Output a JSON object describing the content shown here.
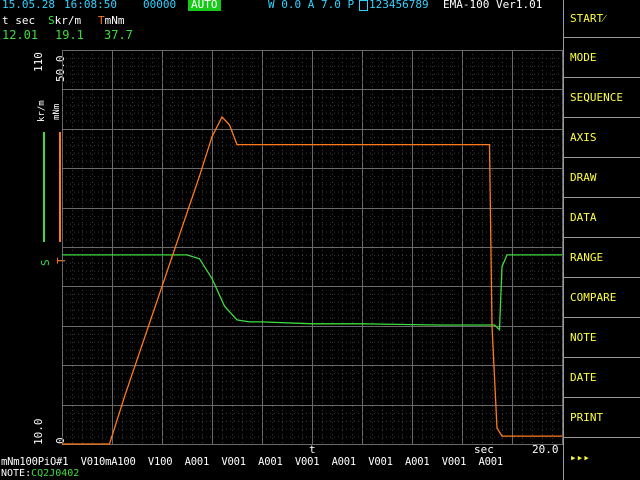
{
  "header": {
    "date": "15.05.28",
    "time": "16:08:50",
    "counter": "00000",
    "auto_badge": "AUTO",
    "mode_status": "W 0.0 A 7.0 P",
    "id_icon": "id-card-icon",
    "serial": "123456789",
    "model": "EMA-100 Ver1.01"
  },
  "readout": {
    "t_label": "t sec",
    "s_label": "Skr/m",
    "s_prefix": "S",
    "s_suffix": "kr/m",
    "t_chan_prefix": "T",
    "t_chan_suffix": "mNm",
    "t_value": "12.01",
    "s_value": "19.1",
    "tq_value": "37.7"
  },
  "axes": {
    "s_unit": "kr/m",
    "t_unit": "mNm",
    "s_max": "110",
    "t_max": "50.0",
    "s_min": "10.0",
    "t_min": "0",
    "s_marker": "S",
    "t_marker": "T",
    "x_label": "t",
    "x_unit": "sec",
    "x_max": "20.0"
  },
  "footer": {
    "config_line": "mNm100PiO#1  V010mA100  V100  A001  V001  A001  V001  A001  V001  A001  V001  A001",
    "note_label": "NOTE:",
    "note_value": "CQ2J0402"
  },
  "sidebar": {
    "items": [
      {
        "label": "START⁄"
      },
      {
        "label": "MODE"
      },
      {
        "label": "SEQUENCE"
      },
      {
        "label": "AXIS"
      },
      {
        "label": "DRAW"
      },
      {
        "label": "DATA"
      },
      {
        "label": "RANGE"
      },
      {
        "label": "COMPARE"
      },
      {
        "label": "NOTE"
      },
      {
        "label": "DATE"
      },
      {
        "label": "PRINT"
      },
      {
        "label": "▸▸▸"
      }
    ]
  },
  "colors": {
    "speed": "#3ddc3d",
    "torque": "#ff7a1a",
    "grid": "#6a6a6a",
    "header_cyan": "#32d2ff",
    "menu_text": "#ffff3c"
  },
  "chart_data": {
    "type": "line",
    "xlabel": "t",
    "x_unit": "sec",
    "xlim": [
      0,
      20
    ],
    "series": [
      {
        "name": "S",
        "unit": "kr/m",
        "ylim": [
          10,
          110
        ],
        "x": [
          0,
          1.5,
          3,
          4.6,
          5.0,
          5.5,
          6.0,
          6.5,
          7.0,
          7.5,
          8.0,
          10,
          12,
          15,
          17.3,
          17.5,
          17.6,
          17.8,
          20
        ],
        "values": [
          58,
          58,
          58,
          58,
          58,
          57,
          52,
          45,
          41.5,
          41,
          41,
          40.5,
          40.5,
          40.2,
          40.2,
          39,
          55,
          58,
          58
        ]
      },
      {
        "name": "T",
        "unit": "mNm",
        "ylim": [
          0,
          50
        ],
        "x": [
          0,
          1.9,
          2.5,
          4,
          5.5,
          6.0,
          6.4,
          6.7,
          7.0,
          9,
          12,
          15,
          17.1,
          17.2,
          17.4,
          17.6,
          20
        ],
        "values": [
          0,
          0,
          6,
          20,
          34,
          39,
          41.5,
          40.5,
          38,
          38,
          38,
          38,
          38,
          15,
          2,
          1,
          1
        ]
      }
    ]
  }
}
